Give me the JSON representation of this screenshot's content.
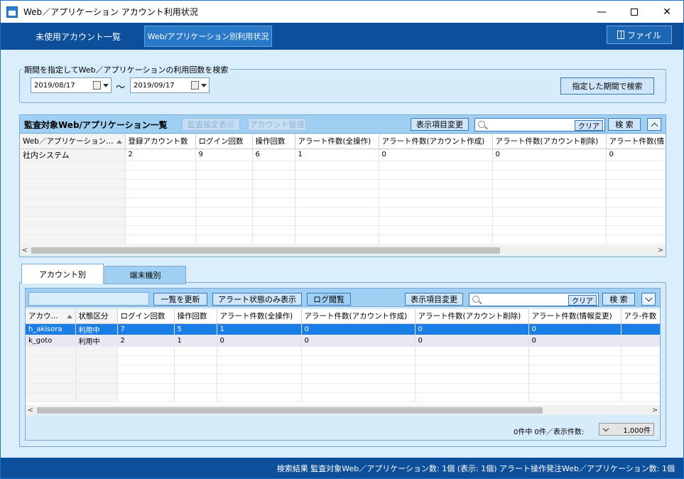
{
  "window": {
    "title": "Web／アプリケーション アカウント利用状況",
    "controls": [
      "minimize",
      "maximize",
      "close"
    ]
  },
  "topnav": {
    "tabs": [
      {
        "label": "未使用アカウント一覧",
        "active": false
      },
      {
        "label": "Web/アプリケーション別利用状況",
        "active": true
      }
    ],
    "file_button": "ファイル"
  },
  "period": {
    "legend": "期間を指定してWeb／アプリケーションの利用回数を検索",
    "from": "2019/08/17",
    "separator": "～",
    "to": "2019/09/17",
    "search_button": "指定した期間で検索"
  },
  "upper": {
    "title": "監査対象Web/アプリケーション一覧",
    "buttons": {
      "audit_settings": "監査設定表示",
      "account_mgmt": "アカウント管理",
      "columns": "表示項目変更",
      "clear": "クリア",
      "search": "検 索"
    },
    "columns": [
      "Web／アプリケーション…",
      "登録アカウント数",
      "ログイン回数",
      "操作回数",
      "アラート件数(全操作)",
      "アラート件数(アカウント作成)",
      "アラート件数(アカウント削除)",
      "アラート件数(情"
    ],
    "rows": [
      [
        "社内システム",
        "2",
        "9",
        "6",
        "1",
        "0",
        "0",
        "0"
      ]
    ]
  },
  "lower": {
    "tabs": [
      {
        "label": "アカウント別",
        "active": true
      },
      {
        "label": "端末機別",
        "active": false
      }
    ],
    "buttons": {
      "refresh": "一覧を更新",
      "alert_only": "アラート状態のみ表示",
      "log_view": "ログ閲覧",
      "columns": "表示項目変更",
      "clear": "クリア",
      "search": "検 索"
    },
    "columns": [
      "アカウ…",
      "状態区分",
      "ログイン回数",
      "操作回数",
      "アラート件数(全操作)",
      "アラート件数(アカウント作成)",
      "アラート件数(アカウント削除)",
      "アラート件数(情報変更)",
      "アラ-件数"
    ],
    "rows": [
      [
        "h_akisora",
        "利用中",
        "7",
        "5",
        "1",
        "0",
        "0",
        "0",
        ""
      ],
      [
        "k_goto",
        "利用中",
        "2",
        "1",
        "0",
        "0",
        "0",
        "0",
        ""
      ]
    ],
    "pager": {
      "summary": "0件中 0件／表示件数:",
      "per_page": "1,000件"
    }
  },
  "statusbar": {
    "text": "検索結果 監査対象Web／アプリケーション数: 1個 (表示: 1個) アラート操作発注Web／アプリケーション数: 1個"
  }
}
